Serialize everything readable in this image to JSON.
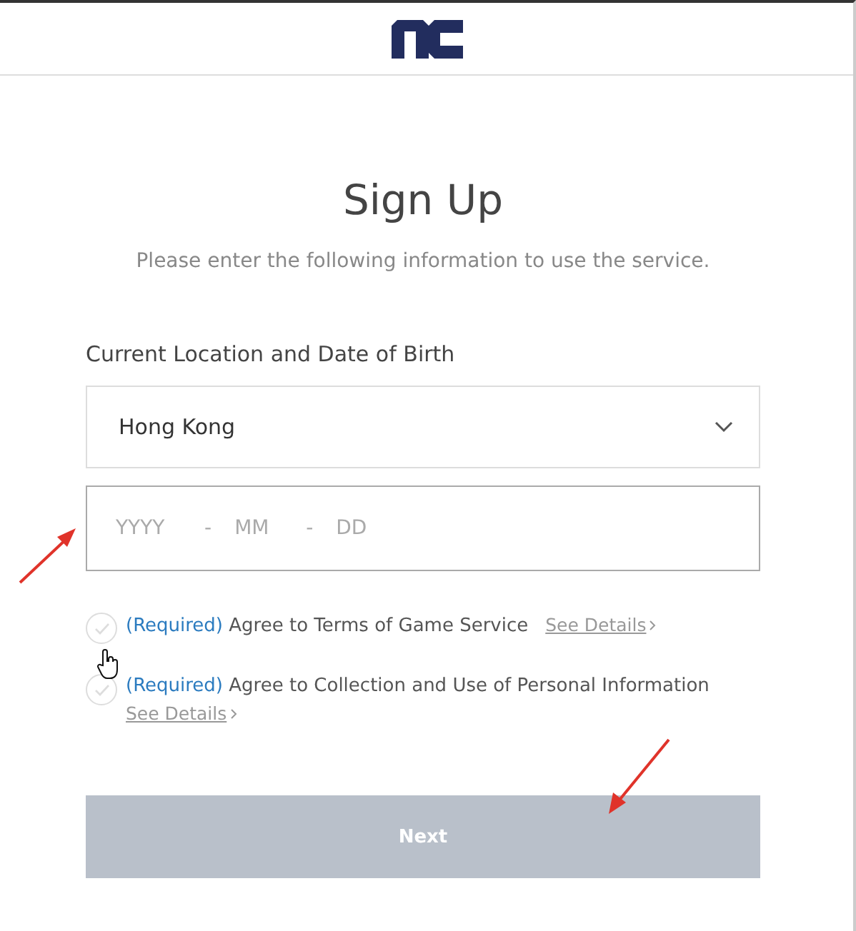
{
  "title": "Sign Up",
  "subtitle": "Please enter the following information to use the service.",
  "section_label": "Current Location and Date of Birth",
  "location_select": {
    "value": "Hong Kong"
  },
  "birth_date": {
    "parts": [
      {
        "placeholder": "YYYY"
      },
      {
        "placeholder": "MM"
      },
      {
        "placeholder": "DD"
      }
    ],
    "separators": [
      "-",
      "-"
    ]
  },
  "agreements": [
    {
      "tag": "(Required)",
      "text": "Agree to Terms of Game Service",
      "link": "See Details",
      "checked": false,
      "link_below": false
    },
    {
      "tag": "(Required)",
      "text": "Agree to Collection and Use of Personal Information",
      "link": "See Details",
      "checked": false,
      "link_below": true
    }
  ],
  "next_button": {
    "label": "Next",
    "disabled": true
  }
}
